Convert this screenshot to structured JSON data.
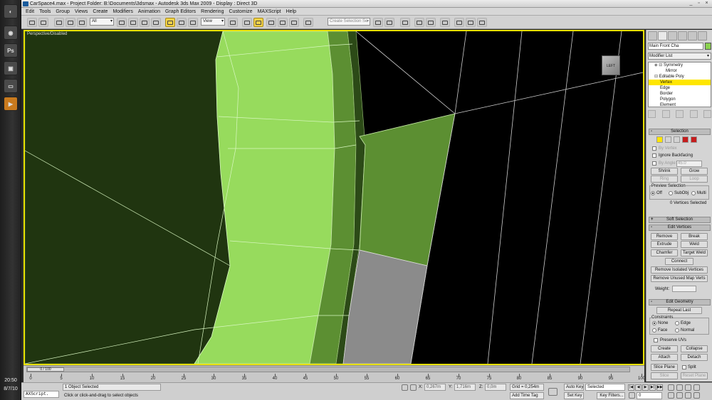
{
  "window": {
    "title": "CarSpace4.max      - Project Folder: B:\\Documents\\3dsmax     - Autodesk 3ds Max  2009      - Display : Direct 3D"
  },
  "menu": [
    "Edit",
    "Tools",
    "Group",
    "Views",
    "Create",
    "Modifiers",
    "Animation",
    "Graph Editors",
    "Rendering",
    "Customize",
    "MAXScript",
    "Help"
  ],
  "toolbar": {
    "filter_value": "All",
    "refcoord_value": "View",
    "named_selection_placeholder": "Create Selection Se"
  },
  "viewport": {
    "label": "Perspective/Disabled",
    "background": "#000000",
    "mesh_dark": "#203510",
    "mesh_light": "#97db5d",
    "mesh_mid": "#5c8f32",
    "gray_face": "#8b8b8b",
    "border_color": "#e8e100"
  },
  "command_panel": {
    "object_name": "Main Front Cha",
    "modifier_list": "Modifier List",
    "stack": [
      "Symmetry",
      "Mirror",
      "Editable Poly",
      "Vertex",
      "Edge",
      "Border",
      "Polygon",
      "Element"
    ],
    "selection": {
      "title": "Selection",
      "by_vertex": "By Vertex",
      "ignore_backfacing": "Ignore Backfacing",
      "by_angle": "By Angle:",
      "by_angle_value": "45.0",
      "shrink": "Shrink",
      "grow": "Grow",
      "ring": "Ring",
      "loop": "Loop",
      "preview_title": "Preview Selection",
      "preview_off": "Off",
      "preview_subobj": "SubObj",
      "preview_multi": "Multi",
      "status": "0 Vertices Selected"
    },
    "soft_selection": {
      "title": "Soft Selection"
    },
    "edit_vertices": {
      "title": "Edit Vertices",
      "remove": "Remove",
      "break": "Break",
      "extrude": "Extrude",
      "weld": "Weld",
      "chamfer": "Chamfer",
      "target_weld": "Target Weld",
      "connect": "Connect",
      "remove_isolated": "Remove Isolated Vertices",
      "remove_unused": "Remove Unused Map Verts",
      "weight_label": "Weight:"
    },
    "edit_geometry": {
      "title": "Edit Geometry",
      "repeat_last": "Repeat Last",
      "constraints": "Constraints",
      "none": "None",
      "edge": "Edge",
      "face": "Face",
      "normal": "Normal",
      "preserve_uvs": "Preserve UVs",
      "create": "Create",
      "collapse": "Collapse",
      "attach": "Attach",
      "detach": "Detach",
      "slice_plane": "Slice Plane",
      "split": "Split",
      "slice": "Slice",
      "reset_plane": "Reset Plane"
    }
  },
  "timeline": {
    "frame_display": "0 / 100",
    "ticks": [
      "0",
      "5",
      "10",
      "15",
      "20",
      "25",
      "30",
      "35",
      "40",
      "45",
      "50",
      "55",
      "60",
      "65",
      "70",
      "75",
      "80",
      "85",
      "90",
      "95",
      "100"
    ]
  },
  "statusbar": {
    "maxscript": "AXScript.",
    "selection_info": "1 Object Selected",
    "prompt": "Click or click-and-drag to select objects",
    "x_label": "X:",
    "x_value": "0,267m",
    "y_label": "Y:",
    "y_value": "1,716m",
    "z_label": "Z:",
    "z_value": "0,0m",
    "grid": "Grid = 0,254m",
    "add_time_tag": "Add Time Tag",
    "auto_key": "Auto Key",
    "set_key": "Set Key",
    "selected_value": "Selected",
    "key_filters": "Key Filters...",
    "current_frame": "0"
  },
  "taskbar": {
    "clock_time": "20:50",
    "clock_date": "8/7/10",
    "icons": [
      "Ps"
    ]
  }
}
